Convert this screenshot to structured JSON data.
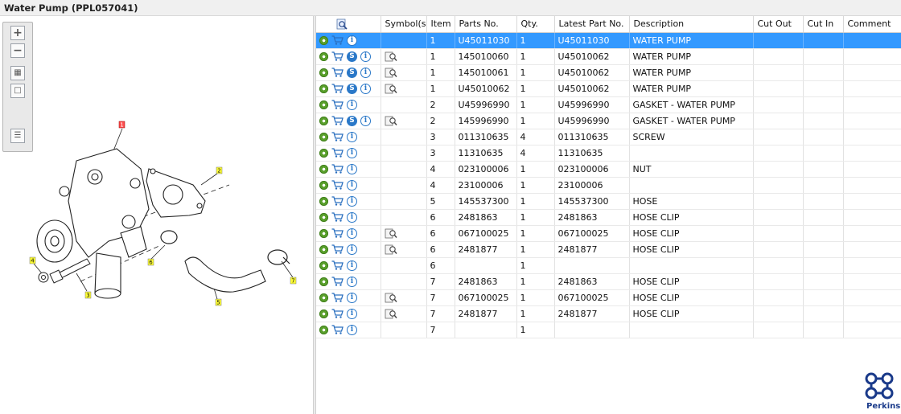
{
  "window": {
    "title": "Water Pump (PPL057041)"
  },
  "brand": {
    "name": "Perkins",
    "color": "#1a3a8a"
  },
  "colors": {
    "selection": "#3399ff",
    "label_yellow": "#ffff33",
    "label_red": "#ff4d4d"
  },
  "zoom_toolbar": {
    "zoom_in_icon": "plus-icon",
    "zoom_out_icon": "minus-icon",
    "fit_icon": "fit-grid-icon",
    "actual_size_icon": "square-icon",
    "toggle_list_icon": "list-arrow-icon"
  },
  "callouts": [
    {
      "label": "1",
      "selected": true
    },
    {
      "label": "2",
      "selected": false
    },
    {
      "label": "3",
      "selected": false
    },
    {
      "label": "4",
      "selected": false
    },
    {
      "label": "5",
      "selected": false
    },
    {
      "label": "6",
      "selected": false
    },
    {
      "label": "7",
      "selected": false
    }
  ],
  "table": {
    "columns": [
      "Symbol(s)",
      "Item",
      "Parts No.",
      "Qty.",
      "Latest Part No.",
      "Description",
      "Cut Out",
      "Cut In",
      "Comment"
    ],
    "header_icon": "search-parts-icon",
    "rows": [
      {
        "s": false,
        "book": false,
        "item": "1",
        "part": "U45011030",
        "qty": "1",
        "latest": "U45011030",
        "desc": "WATER PUMP",
        "selected": true
      },
      {
        "s": true,
        "book": true,
        "item": "1",
        "part": "145010060",
        "qty": "1",
        "latest": "U45010062",
        "desc": "WATER PUMP"
      },
      {
        "s": true,
        "book": true,
        "item": "1",
        "part": "145010061",
        "qty": "1",
        "latest": "U45010062",
        "desc": "WATER PUMP"
      },
      {
        "s": true,
        "book": true,
        "item": "1",
        "part": "U45010062",
        "qty": "1",
        "latest": "U45010062",
        "desc": "WATER PUMP"
      },
      {
        "s": false,
        "book": false,
        "item": "2",
        "part": "U45996990",
        "qty": "1",
        "latest": "U45996990",
        "desc": "GASKET - WATER PUMP"
      },
      {
        "s": true,
        "book": true,
        "item": "2",
        "part": "145996990",
        "qty": "1",
        "latest": "U45996990",
        "desc": "GASKET - WATER PUMP"
      },
      {
        "s": false,
        "book": false,
        "item": "3",
        "part": "011310635",
        "qty": "4",
        "latest": "011310635",
        "desc": "SCREW"
      },
      {
        "s": false,
        "book": false,
        "item": "3",
        "part": "11310635",
        "qty": "4",
        "latest": "11310635",
        "desc": ""
      },
      {
        "s": false,
        "book": false,
        "item": "4",
        "part": "023100006",
        "qty": "1",
        "latest": "023100006",
        "desc": "NUT"
      },
      {
        "s": false,
        "book": false,
        "item": "4",
        "part": "23100006",
        "qty": "1",
        "latest": "23100006",
        "desc": ""
      },
      {
        "s": false,
        "book": false,
        "item": "5",
        "part": "145537300",
        "qty": "1",
        "latest": "145537300",
        "desc": "HOSE"
      },
      {
        "s": false,
        "book": false,
        "item": "6",
        "part": "2481863",
        "qty": "1",
        "latest": "2481863",
        "desc": "HOSE CLIP"
      },
      {
        "s": false,
        "book": true,
        "item": "6",
        "part": "067100025",
        "qty": "1",
        "latest": "067100025",
        "desc": "HOSE CLIP"
      },
      {
        "s": false,
        "book": true,
        "item": "6",
        "part": "2481877",
        "qty": "1",
        "latest": "2481877",
        "desc": "HOSE CLIP"
      },
      {
        "s": false,
        "book": false,
        "item": "6",
        "part": "",
        "qty": "1",
        "latest": "",
        "desc": ""
      },
      {
        "s": false,
        "book": false,
        "item": "7",
        "part": "2481863",
        "qty": "1",
        "latest": "2481863",
        "desc": "HOSE CLIP"
      },
      {
        "s": false,
        "book": true,
        "item": "7",
        "part": "067100025",
        "qty": "1",
        "latest": "067100025",
        "desc": "HOSE CLIP"
      },
      {
        "s": false,
        "book": true,
        "item": "7",
        "part": "2481877",
        "qty": "1",
        "latest": "2481877",
        "desc": "HOSE CLIP"
      },
      {
        "s": false,
        "book": false,
        "item": "7",
        "part": "",
        "qty": "1",
        "latest": "",
        "desc": ""
      }
    ]
  }
}
